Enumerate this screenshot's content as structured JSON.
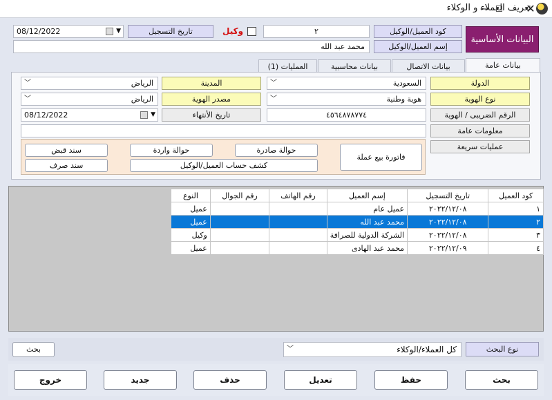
{
  "window": {
    "title": "تعريف العملاء و الوكلاء",
    "minimize": "—",
    "close": "✕"
  },
  "section": {
    "label": "البيانات الأساسية"
  },
  "header": {
    "client_code_label": "كود العميل/الوكيل",
    "client_code_value": "٢",
    "agent_label": "وكيل",
    "agent_checked": false,
    "reg_date_label": "تاريخ التسجيل",
    "reg_date_value": "08/12/2022",
    "client_name_label": "إسم العميل/الوكيل",
    "client_name_value": "محمد عبد الله"
  },
  "tabs": [
    {
      "label": "بيانات عامة",
      "active": true
    },
    {
      "label": "بيانات الاتصال",
      "active": false
    },
    {
      "label": "بيانات محاسبية",
      "active": false
    },
    {
      "label": "العمليات (1)",
      "active": false
    }
  ],
  "general": {
    "country_label": "الدولة",
    "country_value": "السعودية",
    "city_label": "المدينة",
    "city_value": "الرياض",
    "id_type_label": "نوع الهوية",
    "id_type_value": "هوية وطنية",
    "id_source_label": "مصدر الهوية",
    "id_source_value": "الرياض",
    "tax_label": "الرقم الضريبى / الهوية",
    "tax_value": "٤٥٦٤٨٧٨٧٧٤",
    "expiry_label": "تاريخ الأنتهاء",
    "expiry_value": "08/12/2022",
    "info_label": "معلومات عامة",
    "info_value": "",
    "quick_ops_label": "عمليات سريعة"
  },
  "quick_ops": {
    "sales_invoice": "فاتورة بيع عملة",
    "outgoing_transfer": "حوالة صادرة",
    "incoming_transfer": "حوالة واردة",
    "receipt_voucher": "سند قبض",
    "statement": "كشف حساب العميل/الوكيل",
    "payment_voucher": "سند صرف"
  },
  "table": {
    "columns": [
      "كود العميل",
      "تاريخ التسجيل",
      "إسم العميل",
      "رقم الهاتف",
      "رقم الجوال",
      "النوع"
    ],
    "rows": [
      {
        "code": "١",
        "date": "٢٠٢٢/١٢/٠٨",
        "name": "عميل عام",
        "phone": "",
        "mobile": "",
        "type": "عميل",
        "selected": false
      },
      {
        "code": "٢",
        "date": "٢٠٢٢/١٢/٠٨",
        "name": "محمد عبد الله",
        "phone": "",
        "mobile": "",
        "type": "عميل",
        "selected": true
      },
      {
        "code": "٣",
        "date": "٢٠٢٢/١٢/٠٨",
        "name": "الشركة الدولية للصرافة",
        "phone": "",
        "mobile": "",
        "type": "وكيل",
        "selected": false
      },
      {
        "code": "٤",
        "date": "٢٠٢٢/١٢/٠٩",
        "name": "محمد عبد الهادى",
        "phone": "",
        "mobile": "",
        "type": "عميل",
        "selected": false
      }
    ]
  },
  "search": {
    "type_label": "نوع البحث",
    "type_value": "كل العملاء/الوكلاء",
    "button": "بحث"
  },
  "actions": {
    "search": "بحث",
    "save": "حفظ",
    "edit": "تعديل",
    "delete": "حذف",
    "new": "جديد",
    "exit": "خروج"
  },
  "colors": {
    "section_tag": "#8a1f6f",
    "selected_row": "#0a78d7",
    "required_label": "#fbfbb8",
    "agent_label": "#d41010"
  }
}
